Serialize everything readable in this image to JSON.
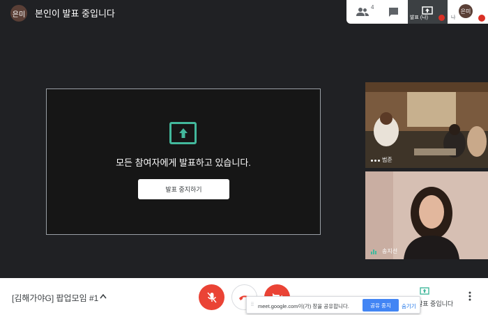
{
  "header": {
    "self_avatar_initials": "은미",
    "presenting_title": "본인이 발표 중입니다"
  },
  "top_panel": {
    "people_icon": "people-icon",
    "people_count": "4",
    "chat_icon": "chat-icon",
    "present_tile_label": "발표 (나)",
    "me_tile_label": "나",
    "me_avatar_initials": "은미"
  },
  "stage": {
    "icon": "present-screen-icon",
    "message": "모든 참여자에게 발표하고 있습니다.",
    "stop_button_label": "발표 중지하기"
  },
  "participants": [
    {
      "name": "범준",
      "audio": "dots"
    },
    {
      "name": "송지선",
      "audio": "bars"
    }
  ],
  "bottom_bar": {
    "meeting_name": "[김해가야G] 팝업모임 #1",
    "presenting_status": "발표 중입니다",
    "accent_mic_color": "#ea4335"
  },
  "share_bar": {
    "message": "meet.google.com이(가) 창을 공유합니다.",
    "stop_label": "공유 중지",
    "hide_label": "숨기기"
  },
  "colors": {
    "accent_green": "#43b89c",
    "danger_red": "#ea4335",
    "primary_blue": "#4285f4"
  }
}
